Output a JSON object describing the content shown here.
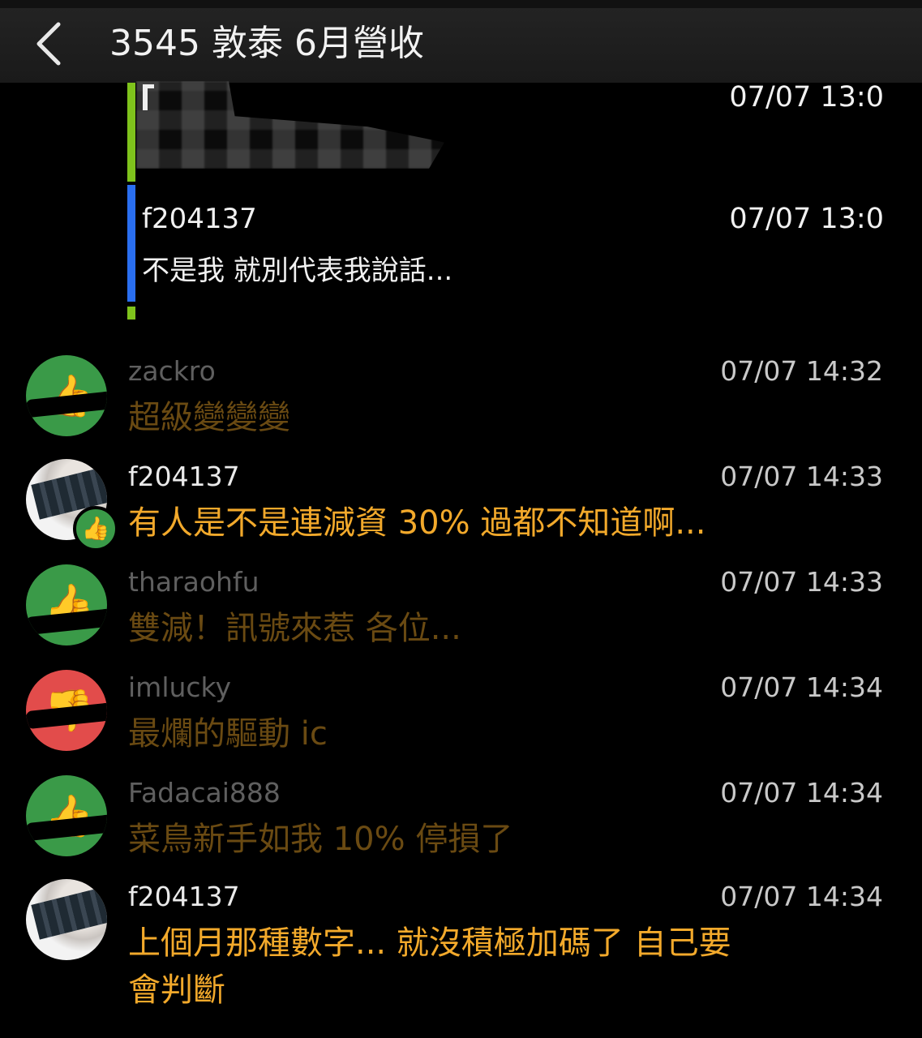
{
  "header": {
    "title": "3545 敦泰 6月營收",
    "back_icon": "chevron-left-icon"
  },
  "quoted": [
    {
      "username": "",
      "text": "",
      "timestamp": "07/07 13:0",
      "bar_color": "#7fc31c",
      "redacted": true
    },
    {
      "username": "f204137",
      "text": "不是我 就別代表我說話...",
      "timestamp": "07/07 13:0",
      "bar_color": "#2a6ff0"
    }
  ],
  "comments": [
    {
      "username": "zackro",
      "timestamp": "07/07 14:32",
      "text": "超級變變變",
      "avatar": "thumbs-up-icon",
      "avatar_color": "#3a9a48",
      "faded": true
    },
    {
      "username": "f204137",
      "timestamp": "07/07 14:33",
      "text": "有人是不是連減資 30% 過都不知道啊...",
      "avatar": "photo-avatar",
      "badge": "thumbs-up-icon",
      "faded": false
    },
    {
      "username": "tharaohfu",
      "timestamp": "07/07 14:33",
      "text": "雙減！訊號來惹 各位...",
      "avatar": "thumbs-up-icon",
      "avatar_color": "#3a9a48",
      "faded": true
    },
    {
      "username": "imlucky",
      "timestamp": "07/07 14:34",
      "text": "最爛的驅動 ic",
      "avatar": "thumbs-down-icon",
      "avatar_color": "#e24c4b",
      "faded": true
    },
    {
      "username": "Fadacai888",
      "timestamp": "07/07 14:34",
      "text": "菜鳥新手如我 10% 停損了",
      "avatar": "thumbs-up-icon",
      "avatar_color": "#3a9a48",
      "faded": true
    },
    {
      "username": "f204137",
      "timestamp": "07/07 14:34",
      "text_line1": "上個月那種數字... 就沒積極加碼了 自己要",
      "text_line2": "會判斷",
      "avatar": "photo-avatar",
      "faded": false
    }
  ]
}
